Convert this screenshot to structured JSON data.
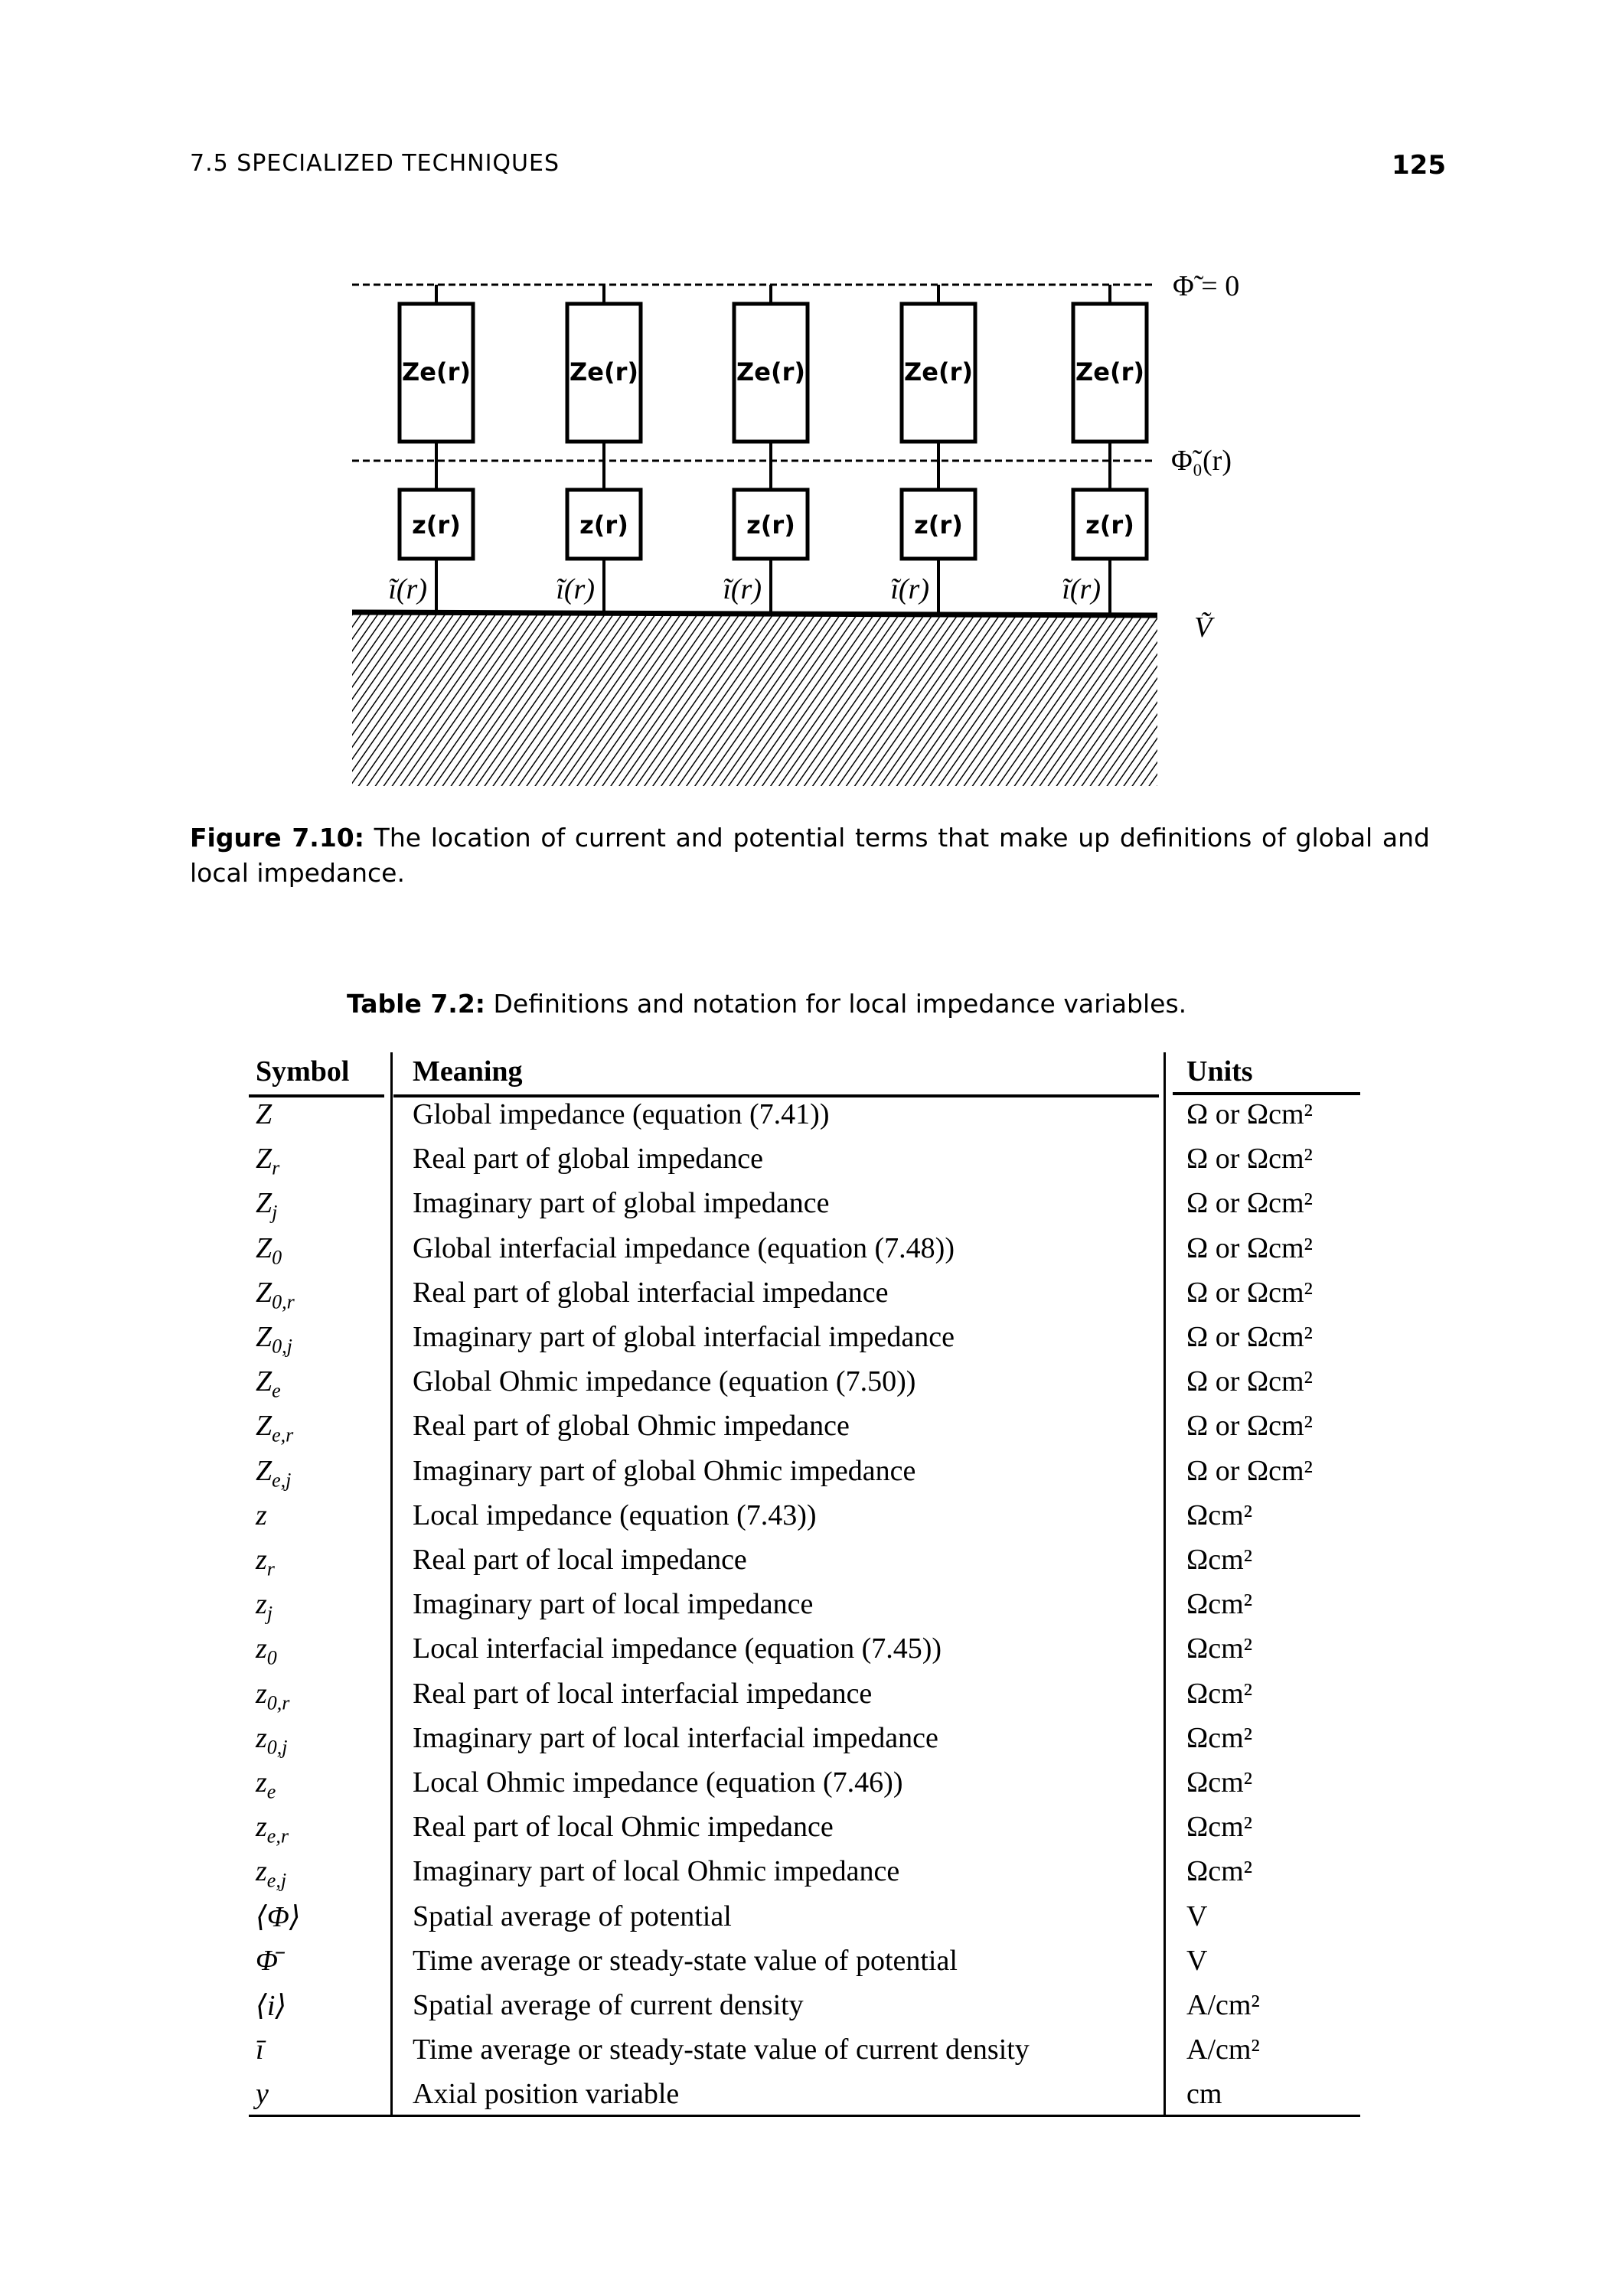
{
  "header": {
    "running_head": "7.5 SPECIALIZED TECHNIQUES",
    "page_number": "125"
  },
  "figure": {
    "columns": 5,
    "upper_box_label": "Ze(r)",
    "lower_box_label": "z(r)",
    "current_label": "ĩ(r)",
    "top_line_label": "Φ̃ = 0",
    "mid_line_label": "Φ̃₀(r)",
    "ground_label": "Ṽ",
    "caption_label": "Figure 7.10:",
    "caption_text": "The location of current and potential terms that make up definitions of global and local impedance."
  },
  "table": {
    "title_label": "Table 7.2:",
    "title_text": "Definitions and notation for local impedance variables.",
    "headers": {
      "symbol": "Symbol",
      "meaning": "Meaning",
      "units": "Units"
    },
    "rows": [
      {
        "symbol": "Z",
        "sub": "",
        "meaning": "Global impedance (equation (7.41))",
        "units": "Ω or Ωcm²"
      },
      {
        "symbol": "Z",
        "sub": "r",
        "meaning": "Real part of global impedance",
        "units": "Ω or Ωcm²"
      },
      {
        "symbol": "Z",
        "sub": "j",
        "meaning": "Imaginary part of global impedance",
        "units": "Ω or Ωcm²"
      },
      {
        "symbol": "Z",
        "sub": "0",
        "meaning": "Global interfacial impedance (equation (7.48))",
        "units": "Ω or Ωcm²"
      },
      {
        "symbol": "Z",
        "sub": "0,r",
        "meaning": "Real part of global interfacial impedance",
        "units": "Ω or Ωcm²"
      },
      {
        "symbol": "Z",
        "sub": "0,j",
        "meaning": "Imaginary part of global interfacial impedance",
        "units": "Ω or Ωcm²"
      },
      {
        "symbol": "Z",
        "sub": "e",
        "meaning": "Global Ohmic impedance (equation (7.50))",
        "units": "Ω or Ωcm²"
      },
      {
        "symbol": "Z",
        "sub": "e,r",
        "meaning": "Real part of global Ohmic impedance",
        "units": "Ω or Ωcm²"
      },
      {
        "symbol": "Z",
        "sub": "e,j",
        "meaning": "Imaginary part of global Ohmic impedance",
        "units": "Ω or Ωcm²"
      },
      {
        "symbol": "z",
        "sub": "",
        "meaning": "Local impedance (equation (7.43))",
        "units": "Ωcm²"
      },
      {
        "symbol": "z",
        "sub": "r",
        "meaning": "Real part of local impedance",
        "units": "Ωcm²"
      },
      {
        "symbol": "z",
        "sub": "j",
        "meaning": "Imaginary part of local impedance",
        "units": "Ωcm²"
      },
      {
        "symbol": "z",
        "sub": "0",
        "meaning": "Local interfacial impedance (equation (7.45))",
        "units": "Ωcm²"
      },
      {
        "symbol": "z",
        "sub": "0,r",
        "meaning": "Real part of local interfacial impedance",
        "units": "Ωcm²"
      },
      {
        "symbol": "z",
        "sub": "0,j",
        "meaning": "Imaginary part of local interfacial impedance",
        "units": "Ωcm²"
      },
      {
        "symbol": "z",
        "sub": "e",
        "meaning": "Local Ohmic impedance (equation (7.46))",
        "units": "Ωcm²"
      },
      {
        "symbol": "z",
        "sub": "e,r",
        "meaning": "Real part of local Ohmic impedance",
        "units": "Ωcm²"
      },
      {
        "symbol": "z",
        "sub": "e,j",
        "meaning": "Imaginary part of local Ohmic impedance",
        "units": "Ωcm²"
      },
      {
        "symbol": "⟨Φ⟩",
        "sub": "",
        "meaning": "Spatial average of potential",
        "units": "V"
      },
      {
        "symbol": "Φ̄",
        "sub": "",
        "meaning": "Time average or steady-state value of potential",
        "units": "V"
      },
      {
        "symbol": "⟨i⟩",
        "sub": "",
        "meaning": "Spatial average of current density",
        "units": "A/cm²"
      },
      {
        "symbol": "ī",
        "sub": "",
        "meaning": "Time average or steady-state value of current density",
        "units": "A/cm²"
      },
      {
        "symbol": "y",
        "sub": "",
        "meaning": "Axial position variable",
        "units": "cm"
      }
    ]
  }
}
